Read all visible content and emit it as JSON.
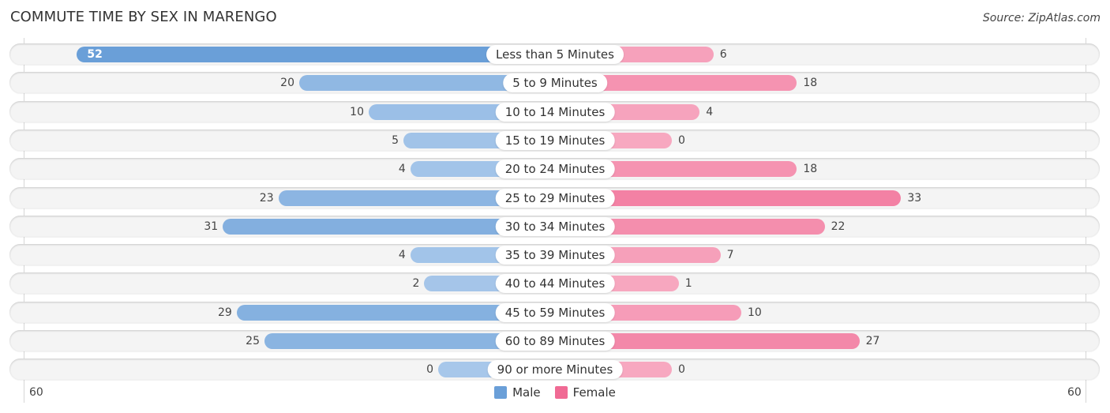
{
  "title": "COMMUTE TIME BY SEX IN MARENGO",
  "source": "Source: ZipAtlas.com",
  "colors": {
    "male": "#6a9fd8",
    "male_light": "#a7c7ea",
    "female": "#f06a94",
    "female_light": "#f7a8c0"
  },
  "legend": {
    "male": "Male",
    "female": "Female"
  },
  "axis": {
    "left_label": "60",
    "right_label": "60"
  },
  "chart_data": {
    "type": "bar",
    "orientation": "horizontal-diverging",
    "title": "COMMUTE TIME BY SEX IN MARENGO",
    "categories": [
      "Less than 5 Minutes",
      "5 to 9 Minutes",
      "10 to 14 Minutes",
      "15 to 19 Minutes",
      "20 to 24 Minutes",
      "25 to 29 Minutes",
      "30 to 34 Minutes",
      "35 to 39 Minutes",
      "40 to 44 Minutes",
      "45 to 59 Minutes",
      "60 to 89 Minutes",
      "90 or more Minutes"
    ],
    "series": [
      {
        "name": "Male",
        "values": [
          52,
          20,
          10,
          5,
          4,
          23,
          31,
          4,
          2,
          29,
          25,
          0
        ]
      },
      {
        "name": "Female",
        "values": [
          6,
          18,
          4,
          0,
          18,
          33,
          22,
          7,
          1,
          10,
          27,
          0
        ]
      }
    ],
    "xlim": [
      -60,
      60
    ],
    "xtick_labels": [
      "60",
      "60"
    ],
    "legend_position": "bottom-center",
    "grid": false
  }
}
